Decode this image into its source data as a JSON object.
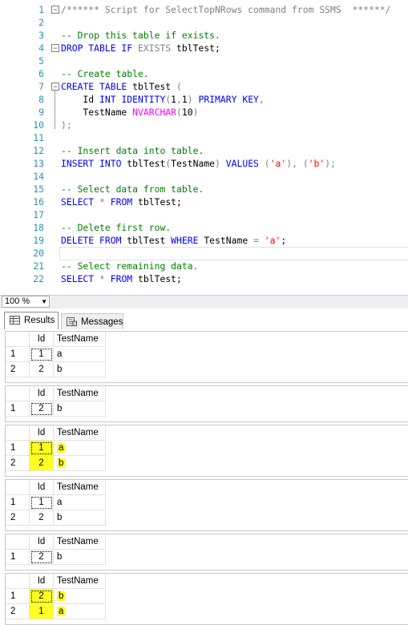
{
  "editor": {
    "lines": [
      {
        "n": "1",
        "parts": [
          {
            "t": "/****** Script for SelectTopNRows command from SSMS  ******/",
            "c": "gr"
          }
        ]
      },
      {
        "n": "2",
        "parts": []
      },
      {
        "n": "3",
        "parts": [
          {
            "t": "-- Drop this table if exists.",
            "c": "cm"
          }
        ]
      },
      {
        "n": "4",
        "parts": [
          {
            "t": "DROP TABLE IF ",
            "c": "kw"
          },
          {
            "t": "EXISTS",
            "c": "gr"
          },
          {
            "t": " tblTest;",
            "c": "tx"
          }
        ]
      },
      {
        "n": "5",
        "parts": []
      },
      {
        "n": "6",
        "parts": [
          {
            "t": "-- Create table.",
            "c": "cm"
          }
        ]
      },
      {
        "n": "7",
        "parts": [
          {
            "t": "CREATE TABLE",
            "c": "kw"
          },
          {
            "t": " tblTest ",
            "c": "tx"
          },
          {
            "t": "(",
            "c": "gr"
          }
        ]
      },
      {
        "n": "8",
        "parts": [
          {
            "t": "    Id ",
            "c": "tx"
          },
          {
            "t": "INT IDENTITY",
            "c": "kw"
          },
          {
            "t": "(",
            "c": "gr"
          },
          {
            "t": "1",
            "c": "tx"
          },
          {
            "t": ",",
            "c": "gr"
          },
          {
            "t": "1",
            "c": "tx"
          },
          {
            "t": ") ",
            "c": "gr"
          },
          {
            "t": "PRIMARY KEY",
            "c": "kw"
          },
          {
            "t": ",",
            "c": "gr"
          }
        ]
      },
      {
        "n": "9",
        "parts": [
          {
            "t": "    TestName ",
            "c": "tx"
          },
          {
            "t": "NVARCHAR",
            "c": "fn"
          },
          {
            "t": "(",
            "c": "gr"
          },
          {
            "t": "10",
            "c": "tx"
          },
          {
            "t": ")",
            "c": "gr"
          }
        ]
      },
      {
        "n": "10",
        "parts": [
          {
            "t": ");",
            "c": "gr"
          }
        ]
      },
      {
        "n": "11",
        "parts": []
      },
      {
        "n": "12",
        "parts": [
          {
            "t": "-- Insert data into table.",
            "c": "cm"
          }
        ]
      },
      {
        "n": "13",
        "parts": [
          {
            "t": "INSERT INTO",
            "c": "kw"
          },
          {
            "t": " tblTest",
            "c": "tx"
          },
          {
            "t": "(",
            "c": "gr"
          },
          {
            "t": "TestName",
            "c": "tx"
          },
          {
            "t": ") ",
            "c": "gr"
          },
          {
            "t": "VALUES ",
            "c": "kw"
          },
          {
            "t": "(",
            "c": "gr"
          },
          {
            "t": "'a'",
            "c": "st"
          },
          {
            "t": "), (",
            "c": "gr"
          },
          {
            "t": "'b'",
            "c": "st"
          },
          {
            "t": ");",
            "c": "gr"
          }
        ]
      },
      {
        "n": "14",
        "parts": []
      },
      {
        "n": "15",
        "parts": [
          {
            "t": "-- Select data from table.",
            "c": "cm"
          }
        ]
      },
      {
        "n": "16",
        "parts": [
          {
            "t": "SELECT ",
            "c": "kw"
          },
          {
            "t": "* ",
            "c": "gr"
          },
          {
            "t": "FROM",
            "c": "kw"
          },
          {
            "t": " tblTest;",
            "c": "tx"
          }
        ]
      },
      {
        "n": "17",
        "parts": []
      },
      {
        "n": "18",
        "parts": [
          {
            "t": "-- Delete first row.",
            "c": "cm"
          }
        ]
      },
      {
        "n": "19",
        "parts": [
          {
            "t": "DELETE FROM",
            "c": "kw"
          },
          {
            "t": " tblTest ",
            "c": "tx"
          },
          {
            "t": "WHERE",
            "c": "kw"
          },
          {
            "t": " TestName ",
            "c": "tx"
          },
          {
            "t": "= ",
            "c": "gr"
          },
          {
            "t": "'a'",
            "c": "st"
          },
          {
            "t": ";",
            "c": "tx"
          }
        ]
      },
      {
        "n": "20",
        "parts": []
      },
      {
        "n": "21",
        "parts": [
          {
            "t": "-- Select remaining data.",
            "c": "cm"
          }
        ]
      },
      {
        "n": "22",
        "parts": [
          {
            "t": "SELECT ",
            "c": "kw"
          },
          {
            "t": "* ",
            "c": "gr"
          },
          {
            "t": "FROM",
            "c": "kw"
          },
          {
            "t": " tblTest;",
            "c": "tx"
          }
        ]
      }
    ]
  },
  "zoom": {
    "value": "100 %"
  },
  "tabs": {
    "results": "Results",
    "messages": "Messages"
  },
  "grids": [
    {
      "headers": [
        "",
        "Id",
        "TestName"
      ],
      "rows": [
        {
          "num": "1",
          "id": "1",
          "name": "a",
          "hl": false
        },
        {
          "num": "2",
          "id": "2",
          "name": "b",
          "hl": false
        }
      ],
      "selected_row": 0
    },
    {
      "headers": [
        "",
        "Id",
        "TestName"
      ],
      "rows": [
        {
          "num": "1",
          "id": "2",
          "name": "b",
          "hl": false
        }
      ],
      "selected_row": 0
    },
    {
      "headers": [
        "",
        "Id",
        "TestName"
      ],
      "rows": [
        {
          "num": "1",
          "id": "1",
          "name": "a",
          "hl": true
        },
        {
          "num": "2",
          "id": "2",
          "name": "b",
          "hl": true
        }
      ],
      "selected_row": 0
    },
    {
      "headers": [
        "",
        "Id",
        "TestName"
      ],
      "rows": [
        {
          "num": "1",
          "id": "1",
          "name": "a",
          "hl": false
        },
        {
          "num": "2",
          "id": "2",
          "name": "b",
          "hl": false
        }
      ],
      "selected_row": 0
    },
    {
      "headers": [
        "",
        "Id",
        "TestName"
      ],
      "rows": [
        {
          "num": "1",
          "id": "2",
          "name": "b",
          "hl": false
        }
      ],
      "selected_row": 0
    },
    {
      "headers": [
        "",
        "Id",
        "TestName"
      ],
      "rows": [
        {
          "num": "1",
          "id": "2",
          "name": "b",
          "hl": true
        },
        {
          "num": "2",
          "id": "1",
          "name": "a",
          "hl": true
        }
      ],
      "selected_row": 0
    }
  ],
  "colors": {
    "highlight": "#ffff22",
    "line_number": "#2b91af",
    "keyword": "#0000ff",
    "comment": "#008000",
    "string": "#ff0000"
  }
}
